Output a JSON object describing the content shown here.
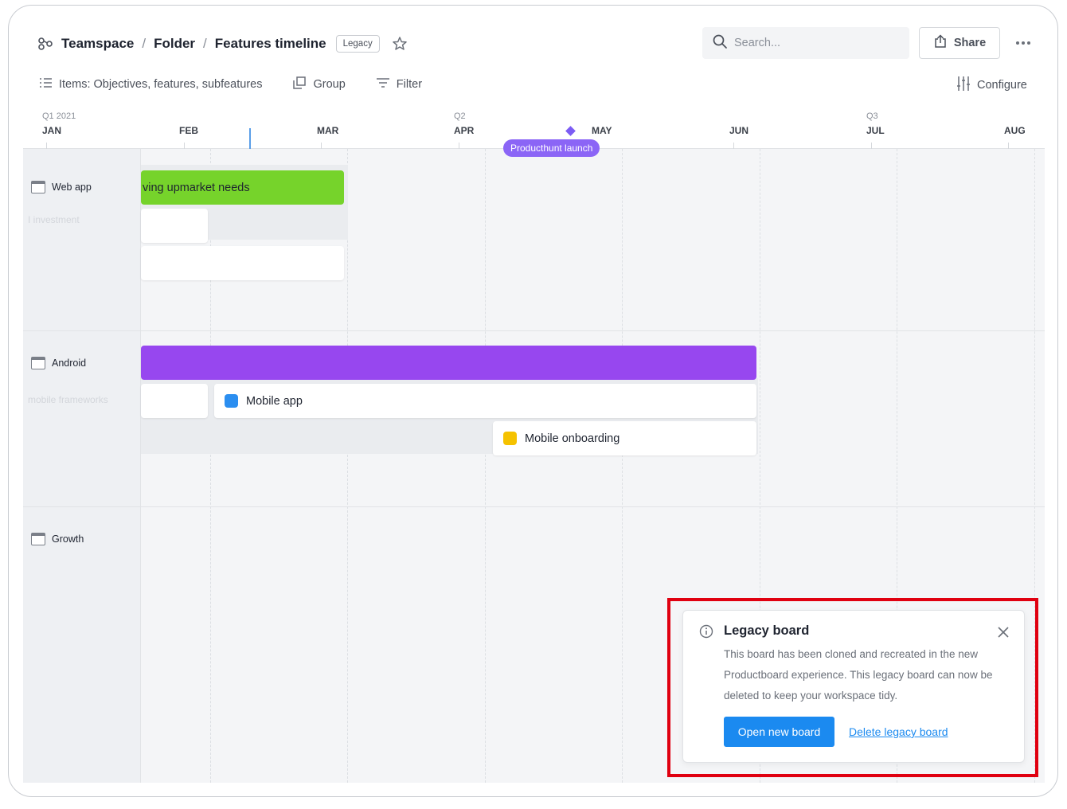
{
  "header": {
    "breadcrumbs": [
      "Teamspace",
      "Folder",
      "Features timeline"
    ],
    "separator": "/",
    "badge": "Legacy",
    "search_placeholder": "Search...",
    "share_label": "Share"
  },
  "toolbar": {
    "items_label": "Items: Objectives, features, subfeatures",
    "group_label": "Group",
    "filter_label": "Filter",
    "configure_label": "Configure"
  },
  "timeline": {
    "quarters": [
      "Q1 2021",
      "Q2",
      "Q3"
    ],
    "months": [
      "JAN",
      "FEB",
      "MAR",
      "APR",
      "MAY",
      "JUN",
      "JUL",
      "AUG"
    ],
    "milestone": "Producthunt launch"
  },
  "groups": [
    {
      "label": "Web app",
      "bar_label": "ving upmarket needs",
      "ghost": [
        "Web app",
        "I investment"
      ]
    },
    {
      "label": "Android",
      "ghost": [
        "Android",
        "mobile frameworks"
      ],
      "cards": [
        {
          "label": "Mobile app",
          "color": "#2b8ef0"
        },
        {
          "label": "Mobile onboarding",
          "color": "#f5c200"
        }
      ]
    },
    {
      "label": "Growth"
    }
  ],
  "popup": {
    "title": "Legacy board",
    "body": "This board has been cloned and recreated in the new Productboard experience. This legacy board can now be deleted to keep your workspace tidy.",
    "primary_label": "Open new board",
    "link_label": "Delete legacy board"
  },
  "colors": {
    "green_bar": "#76d32b",
    "purple_bar": "#9747ef",
    "milestone": "#8b65f6",
    "primary": "#1b8af0",
    "highlight": "#e00010"
  },
  "icons": [
    "teamspace-icon",
    "star-icon",
    "search-icon",
    "share-icon",
    "more-icon",
    "list-icon",
    "group-icon",
    "filter-icon",
    "configure-icon",
    "window-icon",
    "info-icon",
    "close-icon"
  ]
}
